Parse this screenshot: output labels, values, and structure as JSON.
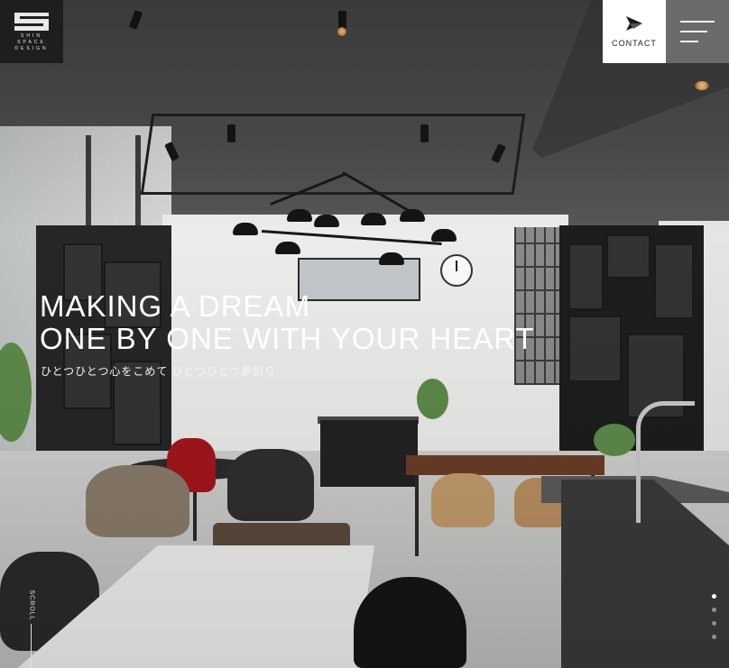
{
  "logo": {
    "line1": "SHIN",
    "line2": "SPACE",
    "line3": "DESIGN"
  },
  "header": {
    "contact_label": "CONTACT",
    "contact_icon": "paper-plane-icon",
    "menu_icon": "hamburger-menu-icon"
  },
  "hero": {
    "headline_line1": "MAKING A DREAM",
    "headline_line2": "ONE BY ONE WITH YOUR HEART",
    "subline": "ひとつひとつ心をこめて ひとつひとつ夢創り"
  },
  "scroll": {
    "label": "SCROLL"
  },
  "pager": {
    "count": 4,
    "active_index": 0
  },
  "colors": {
    "logo_bg": "#1e1e1e",
    "contact_bg": "#ffffff",
    "menu_bg": "#6b6b6b",
    "text_on_photo": "#ffffff"
  }
}
